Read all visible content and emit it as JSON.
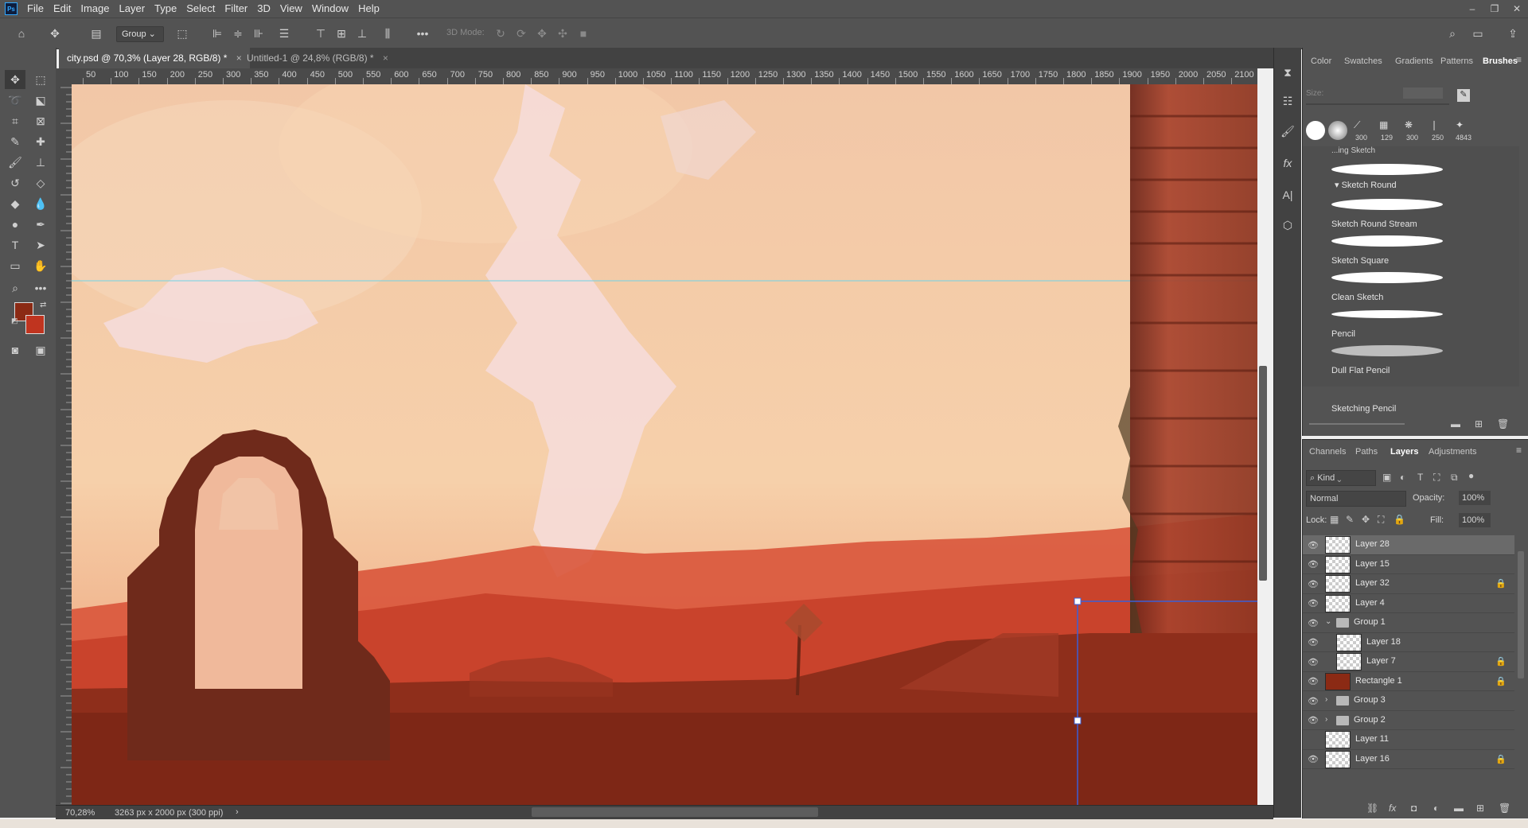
{
  "app": {
    "logo": "Ps"
  },
  "menu": [
    "File",
    "Edit",
    "Image",
    "Layer",
    "Type",
    "Select",
    "Filter",
    "3D",
    "View",
    "Window",
    "Help"
  ],
  "window_controls": {
    "minimize": "–",
    "restore": "❐",
    "close": "✕"
  },
  "options": {
    "auto_select_target": "Group",
    "mode_3d_label": "3D Mode:"
  },
  "tabs": [
    {
      "label": "city.psd @ 70,3% (Layer 28, RGB/8) *",
      "close": "×",
      "active": true
    },
    {
      "label": "Untitled-1 @ 24,8% (RGB/8) *",
      "close": "×",
      "active": false
    }
  ],
  "ruler": {
    "top_ticks": [
      "50",
      "100",
      "150",
      "200",
      "250",
      "300",
      "350",
      "400",
      "450",
      "500",
      "550",
      "600",
      "650",
      "700",
      "750",
      "800",
      "850",
      "900",
      "950",
      "1000",
      "1050",
      "1100",
      "1150",
      "1200",
      "1250",
      "1300",
      "1350",
      "1400",
      "1450",
      "1500",
      "1550",
      "1600",
      "1650",
      "1700",
      "1750",
      "1800",
      "1850",
      "1900",
      "1950",
      "2000",
      "2050",
      "2100"
    ]
  },
  "status": {
    "zoom": "70,28%",
    "doc_info": "3263 px x 2000 px (300 ppi)",
    "arrow": "›"
  },
  "colors": {
    "foreground": "#8b2a14",
    "background": "#c0341f",
    "ui_bg": "#535353",
    "guide": "#6fd3e6",
    "selection": "#3b5fd6"
  },
  "brushes_panel": {
    "tabs": [
      "Color",
      "Swatches",
      "Gradients",
      "Patterns",
      "Brushes"
    ],
    "active_tab": "Brushes",
    "size_label": "Size:",
    "presets": [
      "300",
      "129",
      "300",
      "250",
      "4843"
    ],
    "group_header": "...ing Sketch",
    "group_name": "▾ Sketch Round",
    "brushes": [
      "Sketch Round Stream",
      "Sketch Square",
      "Clean Sketch",
      "Pencil",
      "Dull Flat Pencil",
      "Sketching Pencil"
    ]
  },
  "layers_panel": {
    "tabs": [
      "Channels",
      "Paths",
      "Layers",
      "Adjustments"
    ],
    "active_tab": "Layers",
    "filter_kind": "Kind",
    "blend_mode": "Normal",
    "opacity_label": "Opacity:",
    "opacity": "100%",
    "lock_label": "Lock:",
    "fill_label": "Fill:",
    "fill": "100%",
    "layers": [
      {
        "name": "Layer 28",
        "type": "layer",
        "visible": true,
        "locked": false,
        "selected": true,
        "indent": 0
      },
      {
        "name": "Layer 15",
        "type": "layer",
        "visible": true,
        "locked": false,
        "selected": false,
        "indent": 0
      },
      {
        "name": "Layer 32",
        "type": "layer",
        "visible": true,
        "locked": true,
        "selected": false,
        "indent": 0
      },
      {
        "name": "Layer 4",
        "type": "layer",
        "visible": true,
        "locked": false,
        "selected": false,
        "indent": 0
      },
      {
        "name": "Group 1",
        "type": "group",
        "visible": true,
        "locked": false,
        "selected": false,
        "indent": 0,
        "expanded": true
      },
      {
        "name": "Layer 18",
        "type": "layer",
        "visible": true,
        "locked": false,
        "selected": false,
        "indent": 1
      },
      {
        "name": "Layer 7",
        "type": "layer",
        "visible": true,
        "locked": true,
        "selected": false,
        "indent": 1
      },
      {
        "name": "Rectangle 1",
        "type": "shape",
        "visible": true,
        "locked": true,
        "selected": false,
        "indent": 0
      },
      {
        "name": "Group 3",
        "type": "group",
        "visible": true,
        "locked": false,
        "selected": false,
        "indent": 0,
        "expanded": false
      },
      {
        "name": "Group 2",
        "type": "group",
        "visible": true,
        "locked": false,
        "selected": false,
        "indent": 0,
        "expanded": false
      },
      {
        "name": "Layer 11",
        "type": "layer",
        "visible": false,
        "locked": false,
        "selected": false,
        "indent": 0
      },
      {
        "name": "Layer 16",
        "type": "layer",
        "visible": true,
        "locked": true,
        "selected": false,
        "indent": 0
      }
    ]
  }
}
